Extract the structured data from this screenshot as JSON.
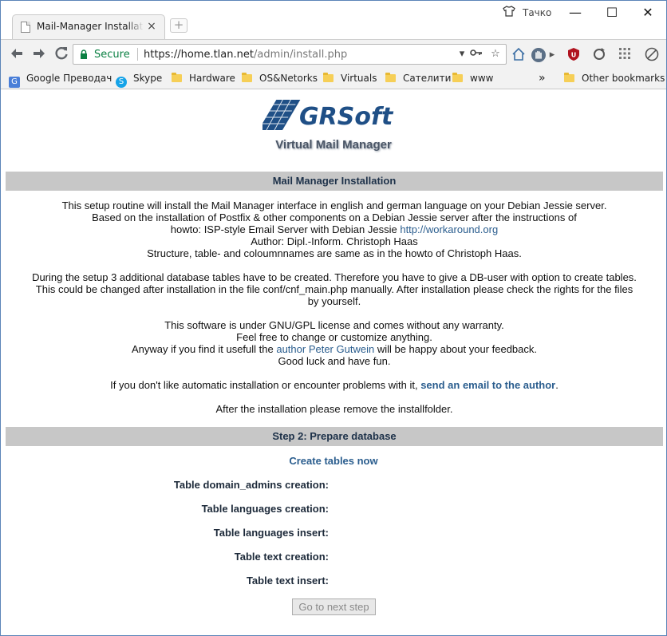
{
  "browser": {
    "tab_title": "Mail-Manager Installation",
    "tab_close": "×",
    "new_tab": "+",
    "profile_name": "Тачко",
    "window_buttons": {
      "minimize": "—",
      "maximize": "☐",
      "close": "✕"
    },
    "security_label": "Secure",
    "url_host": "https://home.tlan.net",
    "url_path": "/admin/install.php",
    "bookmarks": [
      {
        "label": "Google Преводач",
        "icon": "google-translate-icon"
      },
      {
        "label": "Skype",
        "icon": "skype-icon"
      },
      {
        "label": "Hardware",
        "icon": "folder-icon"
      },
      {
        "label": "OS&Netorks",
        "icon": "folder-icon"
      },
      {
        "label": "Virtuals",
        "icon": "folder-icon"
      },
      {
        "label": "Сателити",
        "icon": "folder-icon"
      },
      {
        "label": "www",
        "icon": "folder-icon"
      }
    ],
    "bookmarks_overflow": "»",
    "other_bookmarks": "Other bookmarks"
  },
  "page": {
    "logo_text": "GRSoft",
    "subtitle": "Virtual Mail Manager",
    "installation_header": "Mail Manager Installation",
    "intro": {
      "line1": "This setup routine will install the Mail Manager interface in english and german language on your Debian Jessie server.",
      "line2": "Based on the installation of Postfix & other components on a Debian Jessie server after the instructions of",
      "line3_prefix": "howto: ISP-style Email Server with Debian Jessie ",
      "line3_link": "http://workaround.org",
      "line4": "Author: Dipl.-Inform. Christoph Haas",
      "line5": "Structure, table- and coloumnnames are same as in the howto of Christoph Haas."
    },
    "setup": {
      "line1": "During the setup 3 additional database tables have to be created. Therefore you have to give a DB-user with option to create tables.",
      "line2": "This could be changed after installation in the file conf/cnf_main.php manually. After installation please check the rights for the files",
      "line3": "by yourself."
    },
    "license": {
      "line1": "This software is under GNU/GPL license and comes without any warranty.",
      "line2": "Feel free to change or customize anything.",
      "line3_prefix": "Anyway if you find it usefull the ",
      "line3_link": "author Peter Gutwein",
      "line3_suffix": " will be happy about your feedback.",
      "line4": "Good luck and have fun."
    },
    "contact": {
      "prefix": "If you don't like automatic installation or encounter problems with it, ",
      "link": "send an email to the author",
      "suffix": "."
    },
    "remove_note": "After the installation please remove the installfolder.",
    "step_header": "Step 2: Prepare database",
    "create_tables_link": "Create tables now",
    "status_rows": [
      "Table domain_admins creation:",
      "Table languages creation:",
      "Table languages insert:",
      "Table text creation:",
      "Table text insert:"
    ],
    "next_button": "Go to next step"
  },
  "colors": {
    "section_bar": "#c7c7c7",
    "link": "#2a5d8e",
    "secure": "#0b8043",
    "logo_blue": "#1f4f86"
  }
}
